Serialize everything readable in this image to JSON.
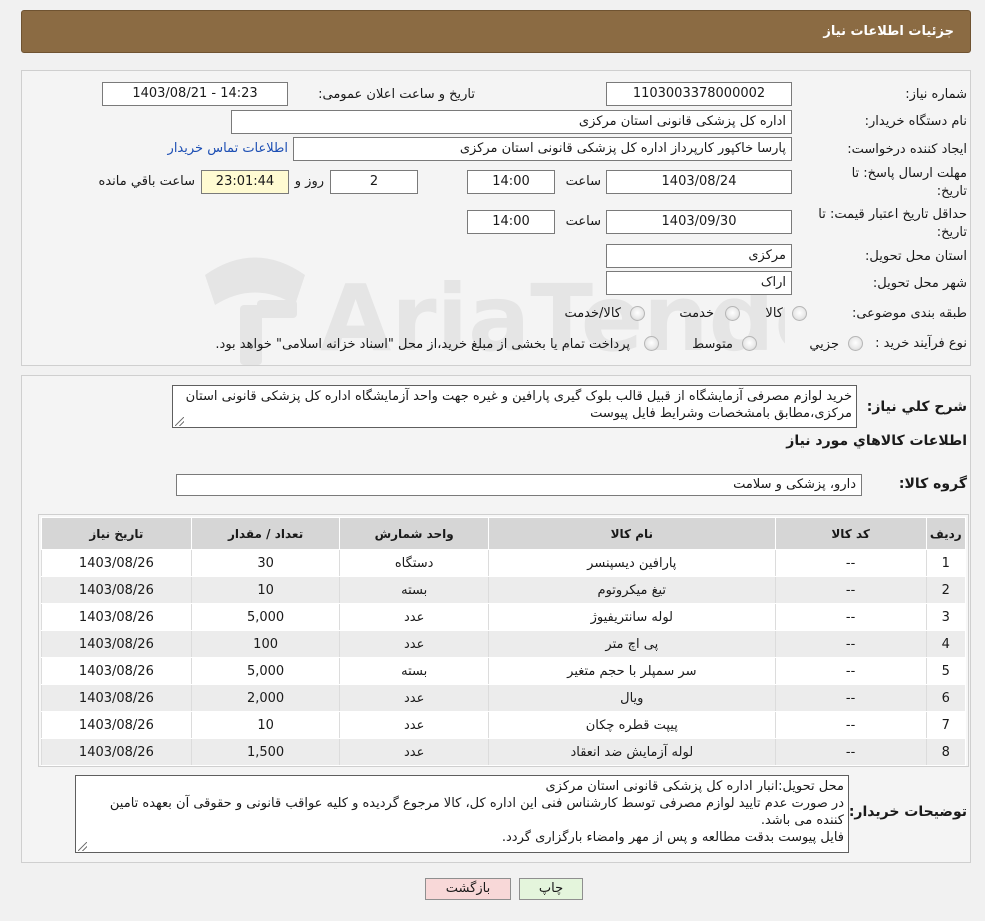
{
  "header": {
    "title": "جزئیات اطلاعات نیاز"
  },
  "need_info": {
    "need_number_label": "شماره نیاز:",
    "need_number": "1103003378000002",
    "announce_label": "تاریخ و ساعت اعلان عمومی:",
    "announce_value": "1403/08/21 - 14:23",
    "buyer_org_label": "نام دستگاه خریدار:",
    "buyer_org": "اداره کل پزشکی قانونی استان مرکزی",
    "requester_label": "ایجاد کننده درخواست:",
    "requester": "پارسا خاکپور کارپرداز اداره کل پزشکی قانونی استان مرکزی",
    "contact_link": "اطلاعات تماس خریدار",
    "reply_deadline_label_1": "مهلت ارسال پاسخ: تا",
    "reply_deadline_label_2": "تاریخ:",
    "reply_date": "1403/08/24",
    "time_label": "ساعت",
    "reply_time": "14:00",
    "days_value": "2",
    "days_label": "روز و",
    "remaining_time": "23:01:44",
    "remaining_label": "ساعت باقي مانده",
    "price_validity_label_1": "حداقل تاریخ اعتبار قیمت: تا",
    "price_validity_label_2": "تاریخ:",
    "price_validity_date": "1403/09/30",
    "price_validity_time": "14:00",
    "province_label": "استان محل تحویل:",
    "province": "مرکزی",
    "city_label": "شهر محل تحویل:",
    "city": "اراک",
    "category_label": "طبقه بندی موضوعی:",
    "category_options": [
      "کالا",
      "خدمت",
      "کالا/خدمت"
    ],
    "process_label": "نوع فرآیند خرید :",
    "process_options": [
      "جزيي",
      "متوسط"
    ],
    "process_note": "پرداخت تمام یا بخشی از مبلغ خرید،از محل \"اسناد خزانه اسلامی\" خواهد بود."
  },
  "description": {
    "label": "شرح کلي نياز:",
    "text": "خرید لوازم مصرفی آزمایشگاه از قبیل قالب بلوک گیری پارافین و غیره جهت واحد آزمایشگاه اداره کل پزشکی قانونی استان مرکزی،مطابق بامشخصات وشرایط فایل پیوست"
  },
  "goods_section_title": "اطلاعات کالاهاي مورد نياز",
  "goods_group": {
    "label": "گروه کالا:",
    "value": "دارو، پزشکی و سلامت"
  },
  "table": {
    "headers": [
      "ردیف",
      "کد کالا",
      "نام کالا",
      "واحد شمارش",
      "تعداد / مقدار",
      "تاریخ نیاز"
    ],
    "rows": [
      [
        "1",
        "--",
        "پارافین دیسپنسر",
        "دستگاه",
        "30",
        "1403/08/26"
      ],
      [
        "2",
        "--",
        "تیغ میکروتوم",
        "بسته",
        "10",
        "1403/08/26"
      ],
      [
        "3",
        "--",
        "لوله سانتریفیوژ",
        "عدد",
        "5,000",
        "1403/08/26"
      ],
      [
        "4",
        "--",
        "پی اچ متر",
        "عدد",
        "100",
        "1403/08/26"
      ],
      [
        "5",
        "--",
        "سر سمپلر با حجم متغیر",
        "بسته",
        "5,000",
        "1403/08/26"
      ],
      [
        "6",
        "--",
        "ویال",
        "عدد",
        "2,000",
        "1403/08/26"
      ],
      [
        "7",
        "--",
        "پیپت قطره چکان",
        "عدد",
        "10",
        "1403/08/26"
      ],
      [
        "8",
        "--",
        "لوله آزمایش ضد انعقاد",
        "عدد",
        "1,500",
        "1403/08/26"
      ]
    ]
  },
  "buyer_notes": {
    "label": "توضیحات خریدار:",
    "lines": [
      "محل تحویل:انبار اداره کل پزشکی قانونی استان مرکزی",
      "در صورت عدم تایید لوازم مصرفی توسط کارشناس فنی این اداره کل، کالا مرجوع گردیده و کلیه عواقب قانونی و حقوقی آن بعهده تامین کننده می باشد.",
      "فایل پیوست بدقت مطالعه و پس از مهر وامضاء بارگزاری گردد."
    ]
  },
  "buttons": {
    "print": "چاپ",
    "back": "بازگشت"
  },
  "watermark": {
    "text": "AriaTender.neT"
  },
  "colors": {
    "header_bg": "#8b6b43",
    "link": "#1d4fb4",
    "timer_bg": "#fffbd2",
    "back_btn_bg": "#f8d8d8",
    "print_btn_bg": "#e4f5dc"
  }
}
